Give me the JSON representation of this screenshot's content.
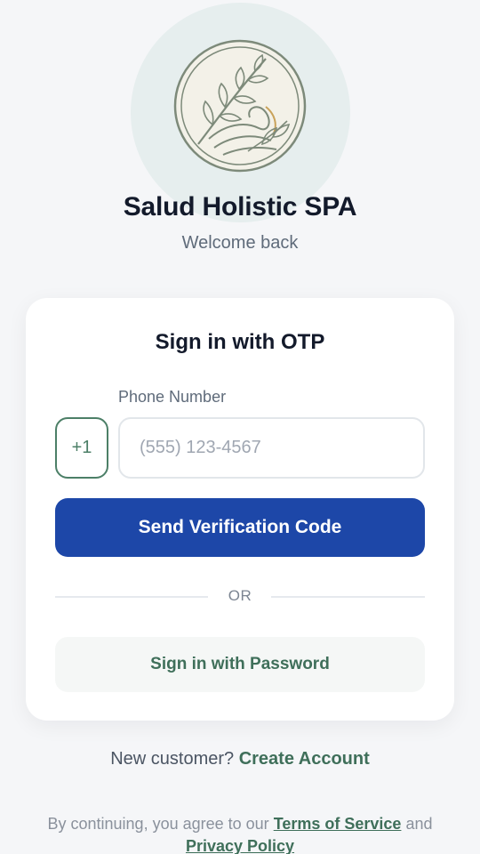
{
  "brand": {
    "title": "Salud Holistic SPA",
    "subtitle": "Welcome back",
    "logo_icon": "leaf-wave-emblem-icon"
  },
  "card": {
    "title": "Sign in with OTP",
    "phone_label": "Phone Number",
    "country_code": "+1",
    "phone_placeholder": "(555) 123-4567",
    "phone_value": "",
    "send_button_label": "Send Verification Code",
    "divider_text": "OR",
    "password_button_label": "Sign in with Password"
  },
  "signup": {
    "prompt": "New customer?",
    "link_label": "Create Account"
  },
  "legal": {
    "prefix": "By continuing, you agree to our",
    "terms_label": "Terms of Service",
    "conjunction": "and",
    "privacy_label": "Privacy Policy"
  },
  "colors": {
    "primary": "#1d47a8",
    "accent_green": "#3f6f5a",
    "background": "#f5f6f8",
    "logo_backdrop": "#e6eeee"
  }
}
